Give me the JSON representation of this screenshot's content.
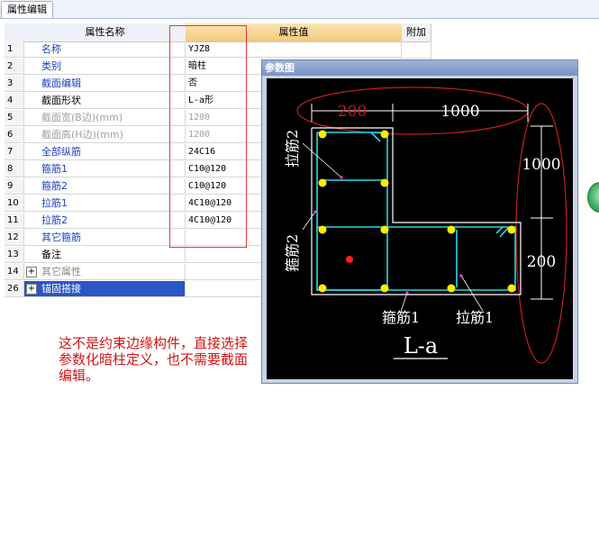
{
  "tab": {
    "label": "属性编辑"
  },
  "table": {
    "headers": {
      "name": "属性名称",
      "value": "属性值",
      "extra": "附加"
    },
    "rows": [
      {
        "index": "1",
        "name": "名称",
        "value": "YJZ8",
        "style": "blue"
      },
      {
        "index": "2",
        "name": "类别",
        "value": "暗柱",
        "style": "blue"
      },
      {
        "index": "3",
        "name": "截面编辑",
        "value": "否",
        "style": "blue"
      },
      {
        "index": "4",
        "name": "截面形状",
        "value": "L-a形",
        "style": "black"
      },
      {
        "index": "5",
        "name": "截面宽(B边)(mm)",
        "value": "1200",
        "style": "gray"
      },
      {
        "index": "6",
        "name": "截面高(H边)(mm)",
        "value": "1200",
        "style": "gray"
      },
      {
        "index": "7",
        "name": "全部纵筋",
        "value": "24C16",
        "style": "blue"
      },
      {
        "index": "8",
        "name": "箍筋1",
        "value": "C10@120",
        "style": "blue"
      },
      {
        "index": "9",
        "name": "箍筋2",
        "value": "C10@120",
        "style": "blue"
      },
      {
        "index": "10",
        "name": "拉筋1",
        "value": "4C10@120",
        "style": "blue"
      },
      {
        "index": "11",
        "name": "拉筋2",
        "value": "4C10@120",
        "style": "blue"
      },
      {
        "index": "12",
        "name": "其它箍筋",
        "value": "",
        "style": "blue"
      },
      {
        "index": "13",
        "name": "备注",
        "value": "",
        "style": "black"
      },
      {
        "index": "14",
        "name": "其它属性",
        "value": "",
        "style": "gray",
        "expander": "+"
      },
      {
        "index": "26",
        "name": "锚固搭接",
        "value": "",
        "style": "selected",
        "expander": "+"
      }
    ]
  },
  "panel": {
    "title": "参数图",
    "dims": {
      "top_left": "200",
      "top_right": "1000",
      "right_top": "1000",
      "right_bottom": "200"
    },
    "labels": {
      "lajin2": "拉筋2",
      "gujin2": "箍筋2",
      "gujin1": "箍筋1",
      "lajin1": "拉筋1",
      "shape": "L-a"
    }
  },
  "note": "这不是约束边缘构件，直接选择参数化暗柱定义，也不需要截面编辑。",
  "colors": {
    "annotation_red": "#d11414",
    "rebar_yellow": "#ffee00",
    "stirrup_cyan": "#25d8e6",
    "selected_blue": "#2a56c6"
  }
}
